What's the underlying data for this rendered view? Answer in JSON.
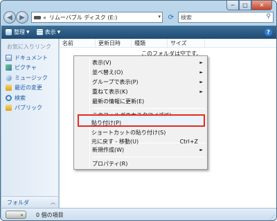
{
  "window": {
    "minimize_icon": "minimize-icon",
    "maximize_icon": "maximize-icon",
    "close_icon": "close-icon",
    "minimize_glyph": "─",
    "maximize_glyph": "□",
    "close_glyph": "✕"
  },
  "nav": {
    "back_glyph": "◀",
    "forward_glyph": "▶",
    "address_chevron": "«",
    "address_text": "リムーバブル ディスク (E:)",
    "address_drop_glyph": "▾",
    "refresh_glyph": "⟳",
    "search_placeholder": "検索",
    "search_glyph": "⚲"
  },
  "toolbar": {
    "organize_label": "整理",
    "view_label": "表示",
    "dropdown_glyph": "▼",
    "help_glyph": "?"
  },
  "navpane": {
    "favorites_title": "お気に入りリンク",
    "items": [
      {
        "label": "ドキュメント",
        "icon": "documents-icon"
      },
      {
        "label": "ピクチャ",
        "icon": "pictures-icon"
      },
      {
        "label": "ミュージック",
        "icon": "music-icon"
      },
      {
        "label": "最近の変更",
        "icon": "recent-changes-icon"
      },
      {
        "label": "検索",
        "icon": "search-icon"
      },
      {
        "label": "パブリック",
        "icon": "public-folder-icon"
      }
    ],
    "folders_label": "フォルダ",
    "folders_chevron": "︿"
  },
  "content": {
    "columns": [
      "名前",
      "更新日時",
      "種類",
      "サイズ"
    ],
    "empty_message": "このフォルダは空です。"
  },
  "context_menu": {
    "items": [
      {
        "label": "表示(V)",
        "submenu": true
      },
      {
        "label": "並べ替え(O)",
        "submenu": true
      },
      {
        "label": "グループで表示(P)",
        "submenu": true
      },
      {
        "label": "重ねて表示(K)",
        "submenu": true
      },
      {
        "label": "最新の情報に更新(E)",
        "submenu": false
      },
      {
        "label": "このフォルダのカスタマイズ(F)...",
        "submenu": false
      },
      {
        "label": "貼り付け(P)",
        "submenu": false,
        "highlighted": true
      },
      {
        "label": "ショートカットの貼り付け(S)",
        "submenu": false
      },
      {
        "label": "元に戻す - 移動(U)",
        "submenu": false,
        "shortcut": "Ctrl+Z"
      },
      {
        "label": "新規作成(W)",
        "submenu": true
      },
      {
        "label": "プロパティ(R)",
        "submenu": false
      }
    ],
    "submenu_glyph": "►",
    "highlight_color": "#e8281e"
  },
  "details": {
    "item_count": "0 個の項目",
    "grip_glyph": "⋰"
  }
}
